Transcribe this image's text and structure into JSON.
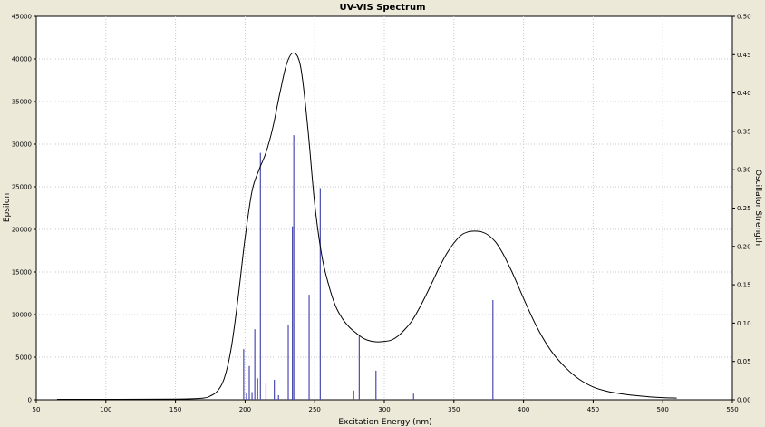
{
  "chart_data": {
    "type": "line",
    "title": "UV-VIS Spectrum",
    "xlabel": "Excitation Energy (nm)",
    "ylabel": "Epsilon",
    "y2label": "Oscillator Strength",
    "xlim": [
      50,
      550
    ],
    "ylim": [
      0,
      45000
    ],
    "y2lim": [
      0,
      0.5
    ],
    "grid": true,
    "x_ticks": [
      "50",
      "100",
      "150",
      "200",
      "250",
      "300",
      "350",
      "400",
      "450",
      "500",
      "550"
    ],
    "y_ticks": [
      "0",
      "5000",
      "10000",
      "15000",
      "20000",
      "25000",
      "30000",
      "35000",
      "40000",
      "45000"
    ],
    "y2_ticks": [
      "0.00",
      "0.05",
      "0.10",
      "0.15",
      "0.20",
      "0.25",
      "0.30",
      "0.35",
      "0.40",
      "0.45",
      "0.50"
    ],
    "colors": {
      "curve": "#000000",
      "sticks": "#4b4bb0",
      "plot_bg": "#ffffff",
      "frame_bg": "#ece9d8",
      "grid": "#c8c8c8"
    },
    "series": [
      {
        "kind": "curve",
        "x": [
          65,
          150,
          170,
          175,
          180,
          185,
          190,
          195,
          200,
          205,
          210,
          215,
          220,
          225,
          230,
          235,
          240,
          245,
          250,
          255,
          260,
          265,
          270,
          275,
          280,
          285,
          290,
          295,
          300,
          305,
          310,
          315,
          320,
          325,
          330,
          335,
          340,
          345,
          350,
          355,
          360,
          365,
          370,
          375,
          380,
          385,
          390,
          395,
          400,
          410,
          420,
          430,
          440,
          450,
          460,
          470,
          480,
          490,
          500,
          510
        ],
        "y": [
          50,
          80,
          200,
          450,
          1000,
          2500,
          6000,
          12000,
          19000,
          24500,
          27000,
          29000,
          32000,
          36000,
          39500,
          40700,
          39000,
          32000,
          23000,
          17000,
          13500,
          11000,
          9500,
          8500,
          7800,
          7200,
          6900,
          6800,
          6850,
          7000,
          7500,
          8300,
          9300,
          10700,
          12300,
          14000,
          15700,
          17200,
          18400,
          19300,
          19700,
          19800,
          19700,
          19300,
          18500,
          17200,
          15600,
          13800,
          11900,
          8400,
          5700,
          3800,
          2400,
          1500,
          1000,
          700,
          500,
          350,
          250,
          200
        ]
      },
      {
        "kind": "sticks",
        "x": [
          199,
          201,
          203,
          205,
          207,
          209,
          211,
          215,
          221,
          224,
          231,
          234,
          235,
          246,
          254,
          278,
          282,
          294,
          321,
          378
        ],
        "y": [
          0.066,
          0.008,
          0.044,
          0.01,
          0.092,
          0.028,
          0.322,
          0.022,
          0.026,
          0.006,
          0.098,
          0.226,
          0.345,
          0.137,
          0.276,
          0.012,
          0.085,
          0.038,
          0.008,
          0.13
        ]
      }
    ]
  }
}
